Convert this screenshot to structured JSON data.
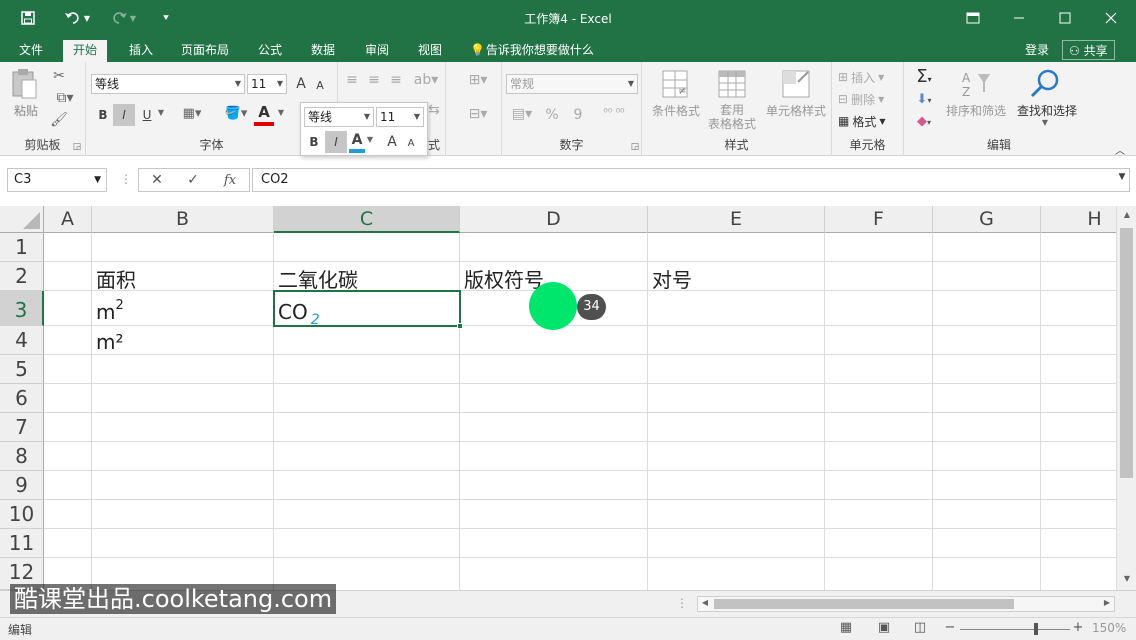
{
  "titlebar": {
    "title": "工作簿4 - Excel",
    "accent": "#217346"
  },
  "tabs": [
    {
      "label": "文件"
    },
    {
      "label": "开始"
    },
    {
      "label": "插入"
    },
    {
      "label": "页面布局"
    },
    {
      "label": "公式"
    },
    {
      "label": "数据"
    },
    {
      "label": "审阅"
    },
    {
      "label": "视图"
    }
  ],
  "tell_me": "告诉我你想要做什么",
  "login": "登录",
  "share": "共享",
  "ribbon": {
    "clipboard": {
      "paste": "粘贴",
      "label": "剪贴板"
    },
    "font": {
      "name": "等线",
      "size": "11",
      "bold": "B",
      "italic": "I",
      "underline": "U",
      "label": "字体",
      "grow": "A",
      "shrink": "A",
      "font_color": "A"
    },
    "mini": {
      "name": "等线",
      "size": "11",
      "bold": "B",
      "italic": "I",
      "font_color": "A",
      "grow": "A",
      "shrink": "A",
      "partial_label": "式"
    },
    "number": {
      "format": "常规",
      "percent": "%",
      "comma": "9",
      "label": "数字"
    },
    "styles": {
      "conditional": "条件格式",
      "table_line1": "套用",
      "table_line2": "表格格式",
      "cell_styles": "单元格样式",
      "label": "样式"
    },
    "cells": {
      "insert": "插入",
      "delete": "删除",
      "format": "格式",
      "label": "单元格"
    },
    "editing": {
      "sort_filter": "排序和筛选",
      "find_select": "查找和选择",
      "label": "编辑"
    }
  },
  "formulabar": {
    "namebox": "C3",
    "cancel": "✕",
    "enter": "✓",
    "fx": "fx",
    "content": "CO2"
  },
  "columns": [
    "A",
    "B",
    "C",
    "D",
    "E",
    "F",
    "G",
    "H"
  ],
  "rows": [
    "1",
    "2",
    "3",
    "4",
    "5",
    "6",
    "7",
    "8",
    "9",
    "10",
    "11",
    "12"
  ],
  "cells": {
    "B2": "面积",
    "C2": "二氧化碳",
    "D2": "版权符号",
    "E2": "对号",
    "B3_base": "m",
    "B3_sup": "2",
    "B4": "m²",
    "C3_base": "CO",
    "C3_sub": "2"
  },
  "status": {
    "mode": "编辑",
    "zoom": "150%"
  },
  "watermark": "酷课堂出品.coolketang.com",
  "step_badge": "34"
}
